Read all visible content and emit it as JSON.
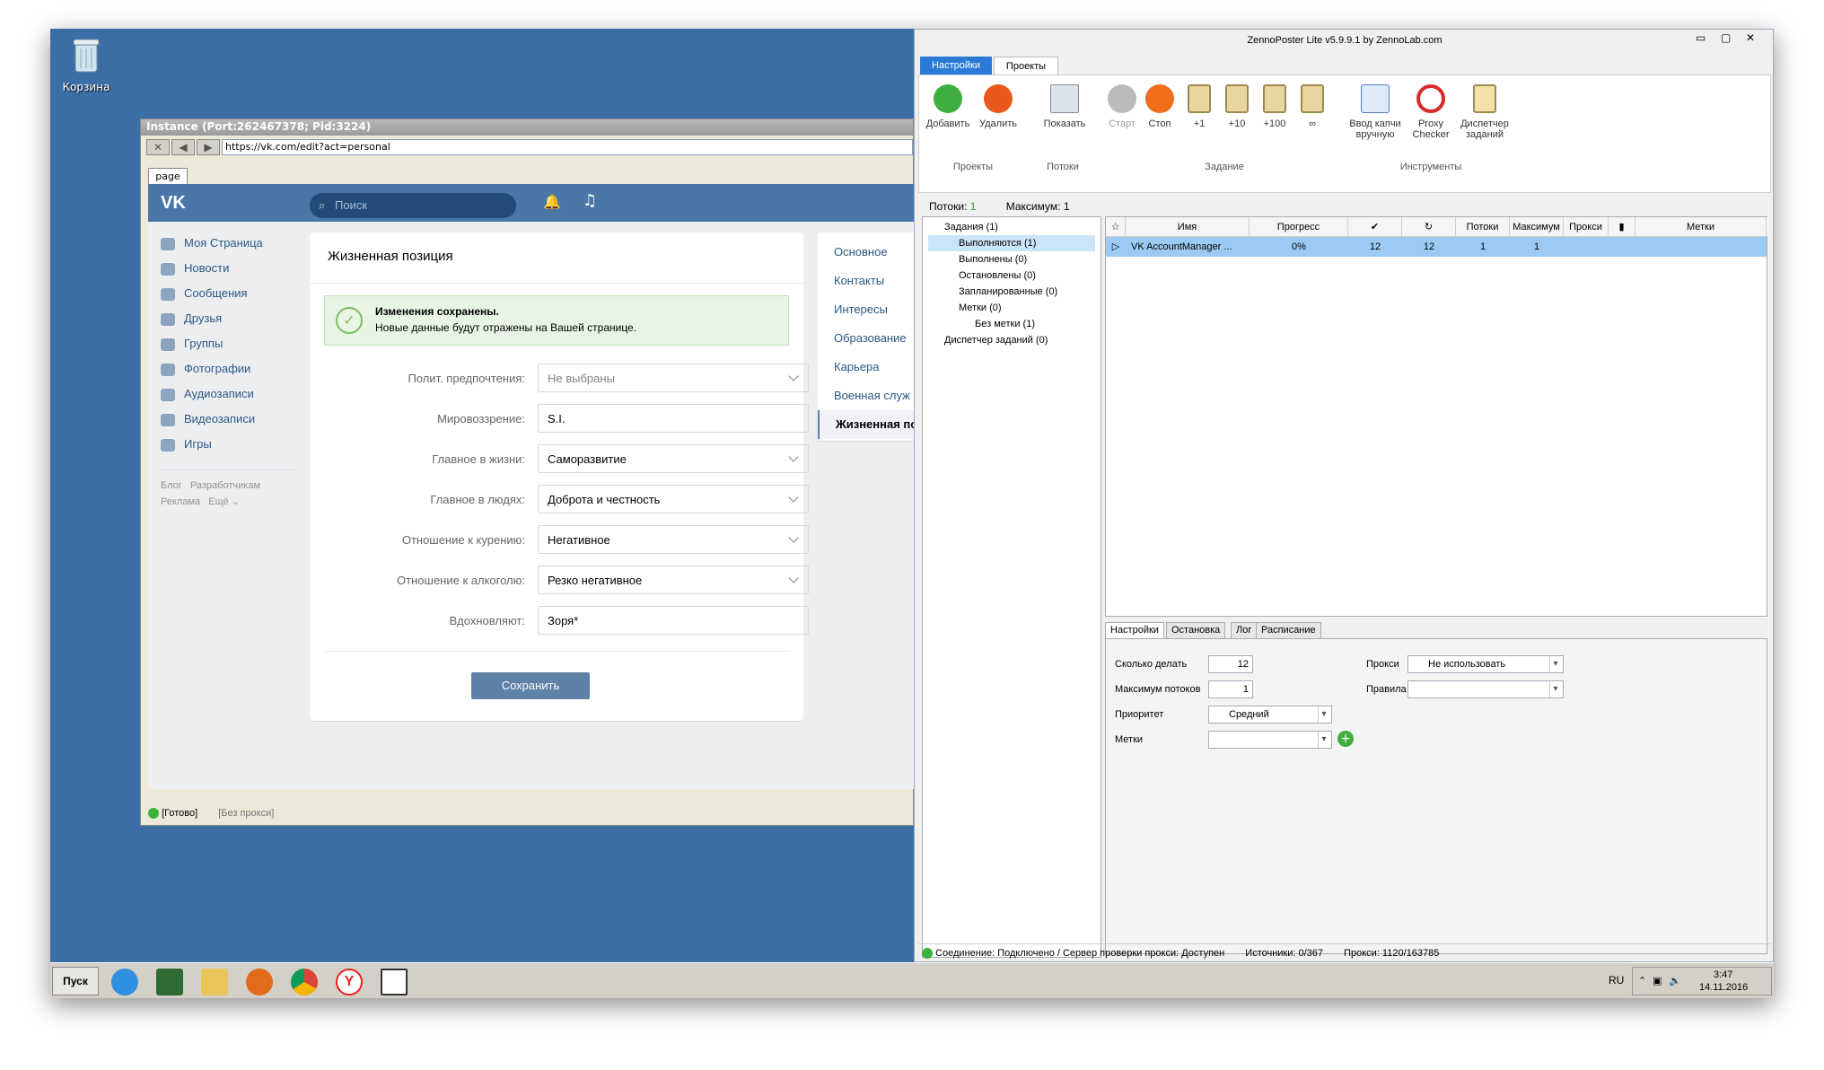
{
  "desktop": {
    "recycle_label": "Корзина"
  },
  "instance": {
    "title": "Instance (Port:262467378; Pid:3224)",
    "url": "https://vk.com/edit?act=personal",
    "tab": "page",
    "status": {
      "ready": "[Готово]",
      "proxy": "[Без прокси]"
    }
  },
  "vk": {
    "search_placeholder": "Поиск",
    "side": [
      "Моя Страница",
      "Новости",
      "Сообщения",
      "Друзья",
      "Группы",
      "Фотографии",
      "Аудиозаписи",
      "Видеозаписи",
      "Игры"
    ],
    "footer": {
      "blog": "Блог",
      "dev": "Разработчикам",
      "ads": "Реклама",
      "more": "Ещё ⌄"
    },
    "card_title": "Жизненная позиция",
    "notice_title": "Изменения сохранены.",
    "notice_text": "Новые данные будут отражены на Вашей странице.",
    "fields": [
      {
        "label": "Полит. предпочтения:",
        "value": "Не выбраны"
      },
      {
        "label": "Мировоззрение:",
        "value": "S.I."
      },
      {
        "label": "Главное в жизни:",
        "value": "Саморазвитие"
      },
      {
        "label": "Главное в людях:",
        "value": "Доброта и честность"
      },
      {
        "label": "Отношение к курению:",
        "value": "Негативное"
      },
      {
        "label": "Отношение к алкоголю:",
        "value": "Резко негативное"
      },
      {
        "label": "Вдохновляют:",
        "value": "Зоря*"
      }
    ],
    "save": "Сохранить",
    "menu": [
      "Основное",
      "Контакты",
      "Интересы",
      "Образование",
      "Карьера",
      "Военная служ",
      "Жизненная по"
    ]
  },
  "zp": {
    "title": "ZennoPoster Lite v5.9.9.1 by ZennoLab.com",
    "tabs": [
      "Настройки",
      "Проекты"
    ],
    "ribbon": {
      "add": "Добавить",
      "del": "Удалить",
      "show": "Показать",
      "start": "Старт",
      "stop": "Стоп",
      "p1": "+1",
      "p10": "+10",
      "p100": "+100",
      "inf": "∞",
      "captcha1": "Ввод капчи",
      "captcha2": "вручную",
      "proxy1": "Proxy",
      "proxy2": "Checker",
      "disp1": "Диспетчер",
      "disp2": "заданий",
      "g_projects": "Проекты",
      "g_threads": "Потоки",
      "g_task": "Задание",
      "g_tools": "Инструменты"
    },
    "threads_label": "Потоки:",
    "threads_val": "1",
    "max_label": "Максимум:",
    "max_val": "1",
    "tree": [
      "Задания (1)",
      "Выполняются (1)",
      "Выполнены (0)",
      "Остановлены (0)",
      "Запланированные (0)",
      "Метки (0)",
      "Без метки (1)",
      "Диспетчер заданий (0)"
    ],
    "cols": {
      "name": "Имя",
      "progress": "Прогресс",
      "done": "✔",
      "repeat": "↻",
      "threads": "Потоки",
      "max": "Максимум",
      "proxy": "Прокси",
      "metki": "Метки"
    },
    "row": {
      "name": "VK AccountManager ...",
      "progress": "0%",
      "done": "12",
      "repeat": "12",
      "threads": "1",
      "max": "1"
    },
    "settings_tabs": [
      "Настройки",
      "Остановка",
      "Лог",
      "Расписание"
    ],
    "settings": {
      "how_many": "Сколько делать",
      "how_many_val": "12",
      "max_threads": "Максимум потоков",
      "max_threads_val": "1",
      "priority": "Приоритет",
      "priority_val": "Средний",
      "labels": "Метки",
      "proxy": "Прокси",
      "proxy_val": "Не использовать",
      "rules": "Правила"
    },
    "status": {
      "conn": "Соединение: Подключено / Сервер проверки прокси: Доступен",
      "sources": "Источники: 0/367",
      "proxies": "Прокси: 1120/163785"
    }
  },
  "taskbar": {
    "start": "Пуск",
    "lang": "RU",
    "time": "3:47",
    "date": "14.11.2016"
  }
}
